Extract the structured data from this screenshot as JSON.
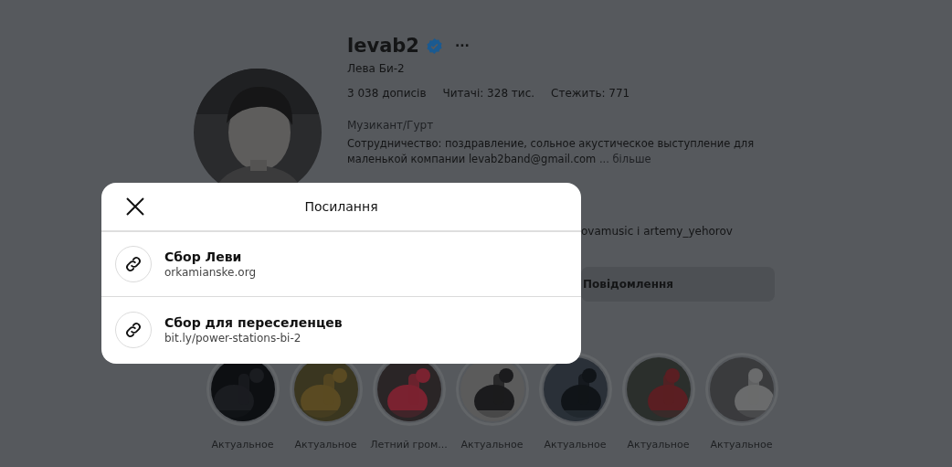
{
  "profile": {
    "username": "levab2",
    "verified": true,
    "more": "···",
    "full_name": "Лева Би-2",
    "stats": [
      {
        "text": "3 038 дописів"
      },
      {
        "text": "Читачі: 328 тис."
      },
      {
        "text": "Стежить: 771"
      }
    ],
    "category": "Музикант/Гурт",
    "bio": "Сотрудничество: поздравление, сольное акустическое выступление для маленькой компании levab2band@gmail.com",
    "bio_more": "... більше",
    "followed_by": "ovamusic і artemy_yehorov",
    "message_button": "Повідомлення"
  },
  "highlights": [
    {
      "label": "Актуальное"
    },
    {
      "label": "Актуальное"
    },
    {
      "label": "Летний гром..."
    },
    {
      "label": "Актуальное"
    },
    {
      "label": "Актуальное"
    },
    {
      "label": "Актуальное"
    },
    {
      "label": "Актуальное"
    }
  ],
  "modal": {
    "title": "Посилання",
    "links": [
      {
        "title": "Сбор Леви",
        "url": "orkamianske.org"
      },
      {
        "title": "Сбор для переселенцев",
        "url": "bit.ly/power-stations-bi-2"
      }
    ]
  }
}
